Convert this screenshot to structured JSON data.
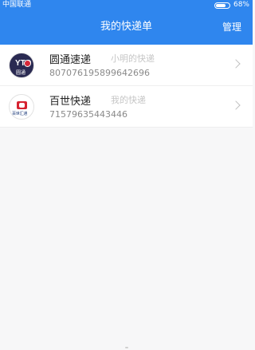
{
  "status_bar": {
    "carrier": "中国联通",
    "battery_text": "68%",
    "battery_level": 0.68
  },
  "header": {
    "title": "我的快递单",
    "manage_label": "管理"
  },
  "parcels": [
    {
      "company": "圆通速递",
      "note": "小明的快递",
      "tracking_number": "807076195899642696",
      "logo": "yto-logo-icon",
      "logo_text": "YTO",
      "logo_sub": "圆通"
    },
    {
      "company": "百世快递",
      "note": "我的快递",
      "tracking_number": "71579635443446",
      "logo": "best-express-logo-icon",
      "logo_sub": "百世汇通"
    }
  ],
  "colors": {
    "accent": "#2f86ee",
    "background": "#f7f7f8"
  }
}
